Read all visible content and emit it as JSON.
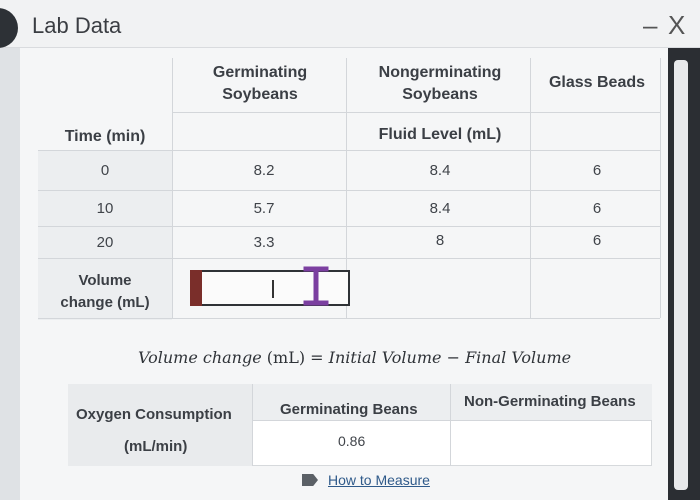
{
  "window": {
    "title": "Lab Data",
    "minimize_glyph": "–",
    "close_glyph": "X"
  },
  "table": {
    "columns": [
      "Germinating\nSoybeans",
      "Nongerminating\nSoybeans",
      "Glass Beads"
    ],
    "row_header": "Time (min)",
    "group_header": "Fluid Level (mL)",
    "rows": [
      {
        "time": "0",
        "germinating": "8.2",
        "nongerminating": "8.4",
        "glass": "6"
      },
      {
        "time": "10",
        "germinating": "5.7",
        "nongerminating": "8.4",
        "glass": "6"
      },
      {
        "time": "20",
        "germinating": "3.3",
        "nongerminating": "8",
        "glass": "6"
      }
    ],
    "volume_change_label": "Volume\nchange (mL)"
  },
  "formula": {
    "lhs_a": "Volume change",
    "lhs_b": "(mL)",
    "eq": "=",
    "rhs_a": "Initial Volume",
    "minus": "−",
    "rhs_b": "Final Volume"
  },
  "oxygen": {
    "label_line1": "Oxygen Consumption",
    "label_line2": "(mL/min)",
    "col1": "Germinating Beans",
    "col2": "Non-Germinating Beans",
    "germinating_value": "0.86",
    "nongerminating_value": ""
  },
  "link": {
    "label": "How to Measure"
  },
  "colors": {
    "accent_red": "#7a2e2a",
    "ibeam": "#7b3fa0"
  }
}
